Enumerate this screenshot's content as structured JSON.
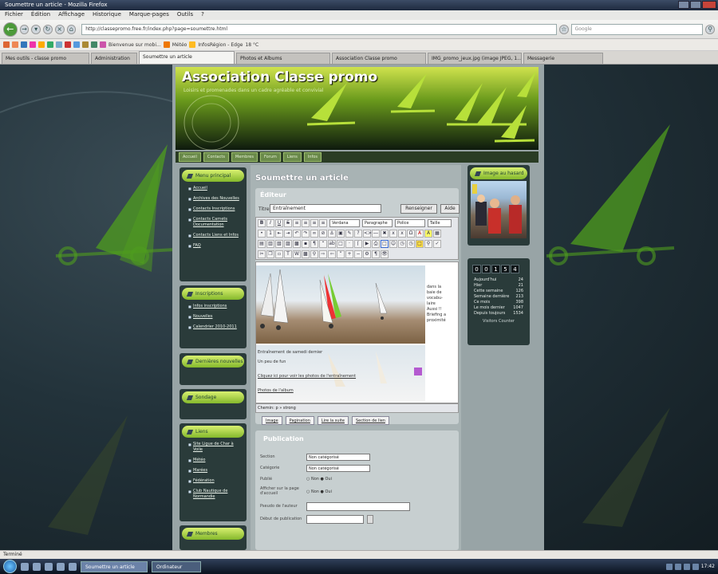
{
  "window": {
    "title": "Soumettre un article - Mozilla Firefox"
  },
  "menu": [
    "Fichier",
    "Édition",
    "Affichage",
    "Historique",
    "Marque-pages",
    "Outils",
    "?"
  ],
  "nav": {
    "url": "http://classepromo.free.fr/index.php?page=soumettre.html",
    "search_placeholder": "Google",
    "bookmarks": [
      "Bienvenue sur mobi...",
      "Météo",
      "InfosRégion - Edge",
      "18 °C"
    ]
  },
  "tabs": [
    {
      "label": "Mes outils - classe promo"
    },
    {
      "label": "Administration"
    },
    {
      "label": "Soumettre un article"
    },
    {
      "label": "Photos et Albums"
    },
    {
      "label": "Association Classe promo"
    },
    {
      "label": "IMG_promo_jeux.jpg (image JPEG, 1...)"
    },
    {
      "label": "Messagerie"
    }
  ],
  "site": {
    "title": "Association Classe promo",
    "subtitle": "Loisirs et promenades dans un cadre agréable et convivial",
    "topnav": [
      "Accueil",
      "Contacts",
      "Membres",
      "Forum",
      "Liens",
      "Infos"
    ]
  },
  "left": {
    "menu_principal": {
      "title": "Menu principal",
      "items": [
        "Accueil",
        "Archives des Nouvelles",
        "Contacts Inscriptions",
        "Contacts Carnets Documentation",
        "Contacts Liens et Infos",
        "FAQ"
      ]
    },
    "inscriptions": {
      "title": "Inscriptions",
      "items": [
        "Infos inscriptions",
        "Nouvelles",
        "Calendrier 2010-2011"
      ]
    },
    "box3": {
      "title": "Dernières nouvelles"
    },
    "box4": {
      "title": "Sondage"
    },
    "liens": {
      "title": "Liens",
      "items": [
        "Site Ligue de Char à Voile",
        "Météo",
        "Marées",
        "Fédération",
        "Club Nautique de Normandie"
      ]
    },
    "box6": {
      "title": "Membres"
    }
  },
  "main": {
    "title": "Soumettre un article",
    "editor_label": "Éditeur",
    "titre_label": "Titre",
    "titre_value": "Entraînement",
    "btn_renseigner": "Renseigner",
    "btn_aide": "Aide",
    "font_select": "Verdana",
    "format_select": "Paragraphe",
    "size_select": "Police",
    "style_select": "Taille",
    "side_text": [
      "dans la",
      "baie de",
      "vocabu-",
      "laire",
      "",
      "Aussi !!",
      "",
      "Briefing a",
      "proximité"
    ],
    "caption": "Entraînement de samedi dernier",
    "link1": "Un peu de fun",
    "link2": "Cliquez ici pour voir les photos de l'entraînement",
    "link3": "Photos de l'album",
    "status": "Chemin: p » strong",
    "under_buttons": [
      "Image",
      "Pagination",
      "Lire la suite",
      "Section de lien"
    ],
    "pub": {
      "title": "Publication",
      "section_label": "Section",
      "section_value": "Non catégorisé",
      "categorie_label": "Catégorie",
      "categorie_value": "Non catégorisé",
      "publie_label": "Publié",
      "accueil_label": "Afficher sur la page d'accueil",
      "radio_non": "Non",
      "radio_oui": "Oui",
      "alias_label": "Pseudo de l'auteur",
      "debut_label": "Début de publication"
    }
  },
  "right": {
    "image_title": "Image au hasard",
    "counter_digits": [
      "0",
      "0",
      "1",
      "5",
      "4"
    ],
    "stats": [
      {
        "label": "Aujourd'hui",
        "value": "24"
      },
      {
        "label": "Hier",
        "value": "21"
      },
      {
        "label": "Cette semaine",
        "value": "126"
      },
      {
        "label": "Semaine dernière",
        "value": "213"
      },
      {
        "label": "Ce mois",
        "value": "398"
      },
      {
        "label": "Le mois dernier",
        "value": "1047"
      },
      {
        "label": "Depuis toujours",
        "value": "1534"
      }
    ],
    "stats_footer": "Visitors Counter"
  },
  "statusbar": {
    "text": "Terminé"
  },
  "taskbar": {
    "tasks": [
      "Soumettre un article",
      "Ordinateur"
    ],
    "clock": "17:42"
  },
  "colors": {
    "accent": "#8ec21f",
    "sidebar_box": "#2a3b3a"
  }
}
